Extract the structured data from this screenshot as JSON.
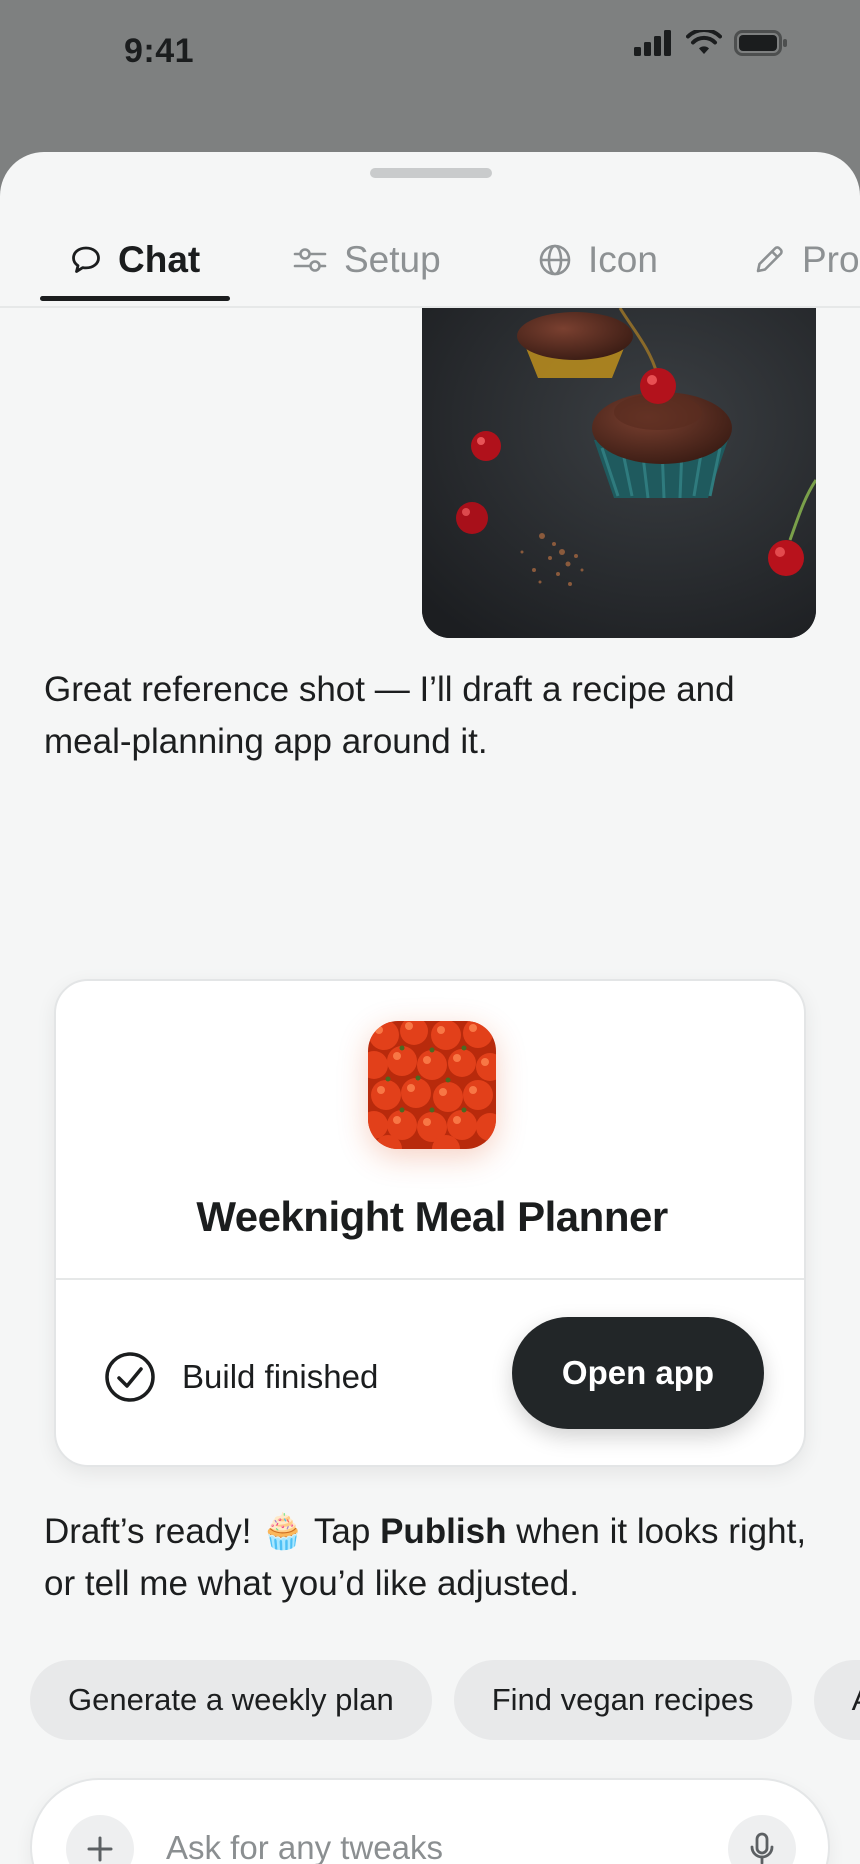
{
  "status_bar": {
    "time": "9:41"
  },
  "tabs": [
    {
      "label": "Chat",
      "icon": "chat-bubble-icon",
      "active": true
    },
    {
      "label": "Setup",
      "icon": "sliders-icon",
      "active": false
    },
    {
      "label": "Icon",
      "icon": "globe-icon",
      "active": false
    },
    {
      "label": "Pro",
      "icon": "pencil-icon",
      "active": false
    }
  ],
  "chat": {
    "reference_image": "chocolate-cupcakes-with-cherries-photo",
    "assistant_message_1": "Great reference shot — I’ll draft a recipe and meal-planning app around it.",
    "app_card": {
      "icon": "cherry-tomatoes-app-icon",
      "app_name": "Weeknight Meal Planner",
      "build_status": "Build finished",
      "open_button": "Open app"
    },
    "assistant_message_2": {
      "before": "Draft’s ready! ",
      "emoji": "🧁",
      "middle": " Tap ",
      "bold": "Publish",
      "after": " when it looks right, or tell me what you’d like adjusted."
    }
  },
  "suggestions": [
    "Generate a weekly plan",
    "Find vegan recipes",
    "A"
  ],
  "composer": {
    "placeholder": "Ask for any tweaks"
  },
  "colors": {
    "accent_dark": "#222628",
    "sheet_bg": "#f5f6f6",
    "backdrop": "#7e8080"
  }
}
